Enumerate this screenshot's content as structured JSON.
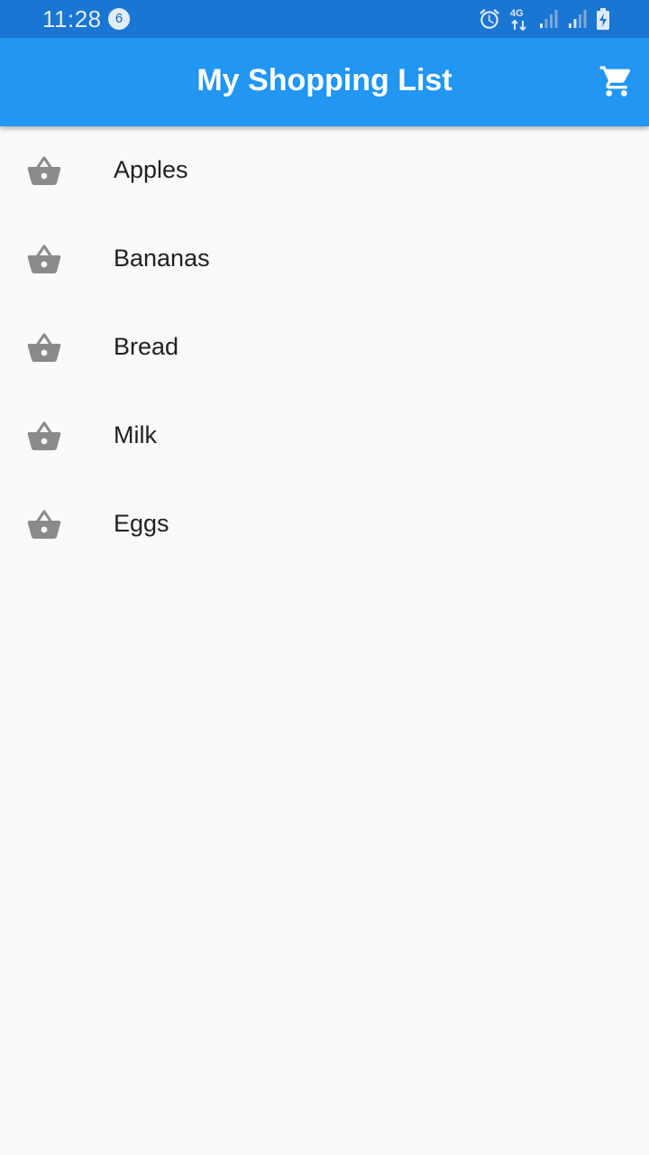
{
  "status_bar": {
    "time": "11:28",
    "notification_count": "6",
    "network_label": "4G",
    "icons": [
      "alarm-icon",
      "network-4g-icon",
      "signal-icon",
      "signal-icon",
      "battery-charging-icon"
    ]
  },
  "app_bar": {
    "title": "My Shopping List",
    "action_icon": "shopping-cart-icon",
    "background_color": "#2196f3"
  },
  "items": [
    {
      "label": "Apples",
      "icon": "shopping-basket-icon"
    },
    {
      "label": "Bananas",
      "icon": "shopping-basket-icon"
    },
    {
      "label": "Bread",
      "icon": "shopping-basket-icon"
    },
    {
      "label": "Milk",
      "icon": "shopping-basket-icon"
    },
    {
      "label": "Eggs",
      "icon": "shopping-basket-icon"
    }
  ],
  "colors": {
    "status_bar": "#1976d2",
    "icon_gray": "#8a8a8a",
    "text": "#212121",
    "background": "#fafafa"
  }
}
